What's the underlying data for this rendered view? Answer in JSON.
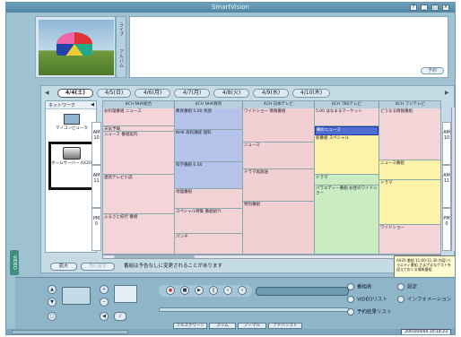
{
  "app": {
    "title": "SmartVision"
  },
  "window_controls": [
    "?",
    "_",
    "□",
    "×"
  ],
  "side_tabs": [
    "ライブ",
    "アルバム"
  ],
  "memo_button": "予約",
  "date_nav": {
    "prev": "◀",
    "next": "▶"
  },
  "date_tabs": [
    "4/4(土)",
    "4/5(日)",
    "4/6(月)",
    "4/7(月)",
    "4/8(火)",
    "4/9(水)",
    "4/10(木)"
  ],
  "network_panel": {
    "header": "ネットワーク",
    "collapse": "◀",
    "devices": [
      "マイコンピュータ",
      "ホームサーバー AX20"
    ]
  },
  "channels": [
    "8CH NHK総合",
    "8CH NHK教育",
    "4CH 日本テレビ",
    "6CH TBSテレビ",
    "8CH フジテレビ"
  ],
  "hours_left": [
    "AM 10",
    "AM 11",
    "PM 0"
  ],
  "hours_right": [
    "AM 10",
    "AM 11",
    "PM 0"
  ],
  "programs": [
    [
      "お料理番組 ニュース",
      "天気予報",
      "ニュース 番組案内",
      "連続テレビ小説",
      "ふるさと紀行 番組"
    ],
    [
      "教育番組 5.00 英語",
      "NHK 高校講座 理科",
      "科学番組 6.00",
      "地理番組",
      "スペシャル特集 番組紹介",
      "パンチ"
    ],
    [
      "ワイドショー 情報番組",
      "ニュース",
      "ドラマ再放送",
      "特別番組"
    ],
    [
      "5.00 はなまるマーケット",
      "朝のニュース",
      "新番組 スペシャル",
      "ドラマ",
      "バラエティー番組 お昼のワイドショー"
    ],
    [
      "どうなる情報番組",
      "ニュース番組",
      "ドラマ",
      "ワイドショー"
    ]
  ],
  "bottom_bar": {
    "expand": "拡大",
    "restore": "元に戻す",
    "hint": "番組は予告なしに変更されることがあります"
  },
  "tooltip": "AX20 番組 11:00-11:30 内容:バラエティ番組 さまざまなゲストを迎えておくる情報番組",
  "video_tab": "VIDEO",
  "controls": {
    "functions": [
      "番組表",
      "VIDEOリスト",
      "予約結果リスト"
    ],
    "functions_right": [
      "設定",
      "インフォメーション"
    ],
    "modes": [
      "フルスクリーン",
      "スリム",
      "ノーマル",
      "アドバンスト"
    ]
  },
  "status": {
    "time": "2003/04/04 10:14:23"
  }
}
